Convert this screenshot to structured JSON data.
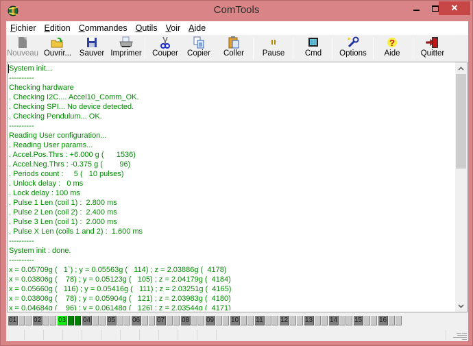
{
  "window": {
    "title": "ComTools",
    "controls": {
      "minimize": "minimize",
      "maximize": "maximize",
      "close": "✕"
    }
  },
  "menu": [
    {
      "label": "Fichier",
      "accel": "F",
      "rest": "ichier"
    },
    {
      "label": "Edition",
      "accel": "E",
      "rest": "dition"
    },
    {
      "label": "Commandes",
      "accel": "C",
      "rest": "ommandes"
    },
    {
      "label": "Outils",
      "accel": "O",
      "rest": "utils"
    },
    {
      "label": "Voir",
      "accel": "V",
      "rest": "oir"
    },
    {
      "label": "Aide",
      "accel": "A",
      "rest": "ide"
    }
  ],
  "toolbar": {
    "nouveau": {
      "label": "Nouveau",
      "icon": "new-file-icon",
      "enabled": false
    },
    "ouvrir": {
      "label": "Ouvrir...",
      "icon": "open-folder-icon",
      "enabled": true
    },
    "sauver": {
      "label": "Sauver",
      "icon": "save-disk-icon",
      "enabled": true
    },
    "imprimer": {
      "label": "Imprimer",
      "icon": "printer-icon",
      "enabled": true
    },
    "couper": {
      "label": "Couper",
      "icon": "scissors-icon",
      "enabled": true
    },
    "copier": {
      "label": "Copier",
      "icon": "copy-icon",
      "enabled": true
    },
    "coller": {
      "label": "Coller",
      "icon": "paste-clipboard-icon",
      "enabled": true
    },
    "pause": {
      "label": "Pause",
      "icon": "pause-icon",
      "enabled": true
    },
    "cmd": {
      "label": "Cmd",
      "icon": "terminal-icon",
      "enabled": true
    },
    "options": {
      "label": "Options",
      "icon": "wrench-icon",
      "enabled": true
    },
    "aide": {
      "label": "Aide",
      "icon": "help-icon",
      "enabled": true
    },
    "quitter": {
      "label": "Quitter",
      "icon": "exit-door-icon",
      "enabled": true
    }
  },
  "log": {
    "lines": [
      "System init...",
      "----------",
      "Checking hardware",
      ". Checking I2C.... Accel10_Comm_OK.",
      ". Checking SPI... No device detected.",
      ". Checking Pendulum... OK.",
      "----------",
      "Reading User configuration...",
      ". Reading User params...",
      ". Accel.Pos.Thrs : +6.000 g (      1536)",
      ". Accel.Neg.Thrs : -0.375 g (        96)",
      ". Periods count :     5 (   10 pulses)",
      ". Unlock delay :   0 ms",
      ". Lock delay : 100 ms",
      ". Pulse 1 Len (coil 1) :  2.800 ms",
      ". Pulse 2 Len (coil 2) :  2.400 ms",
      ". Pulse 3 Len (coil 1) :  2.000 ms",
      ". Pulse X Len (coils 1 and 2) :  1.600 ms",
      "----------",
      "System init : done.",
      "----------",
      "x = 0.05709g (   1`) ; y = 0.05563g (   114) ; z = 2.03886g (  4178)",
      "x = 0.03806g (    78) ; y = 0.05123g (   105) ; z = 2.04179g (  4184)",
      "x = 0.05660g (   116) ; y = 0.05416g (   111) ; z = 2.03251g (  4165)",
      "x = 0.03806g (    78) ; y = 0.05904g (   121) ; z = 2.03983g (  4180)",
      "x = 0.04684g (    96) ; y = 0.06148g (   126) ; z = 2.03544g (  4171)"
    ],
    "text_color": "#008a00",
    "scroll_position": 0.0
  },
  "channels": [
    {
      "label": "01",
      "active": false
    },
    {
      "label": "02",
      "active": false
    },
    {
      "label": "03",
      "active": true
    },
    {
      "label": "04",
      "active": false
    },
    {
      "label": "05",
      "active": false
    },
    {
      "label": "06",
      "active": false
    },
    {
      "label": "07",
      "active": false
    },
    {
      "label": "08",
      "active": false
    },
    {
      "label": "09",
      "active": false
    },
    {
      "label": "10",
      "active": false
    },
    {
      "label": "11",
      "active": false
    },
    {
      "label": "12",
      "active": false
    },
    {
      "label": "13",
      "active": false
    },
    {
      "label": "14",
      "active": false
    },
    {
      "label": "15",
      "active": false
    },
    {
      "label": "16",
      "active": false
    }
  ],
  "colors": {
    "title_bar": "#d98587",
    "close_button": "#c74646",
    "channel_active_label": "#10f010",
    "channel_active_led": "#008000",
    "channel_idle_label": "#7f7f7f",
    "channel_idle_led": "#c8c8c8"
  }
}
